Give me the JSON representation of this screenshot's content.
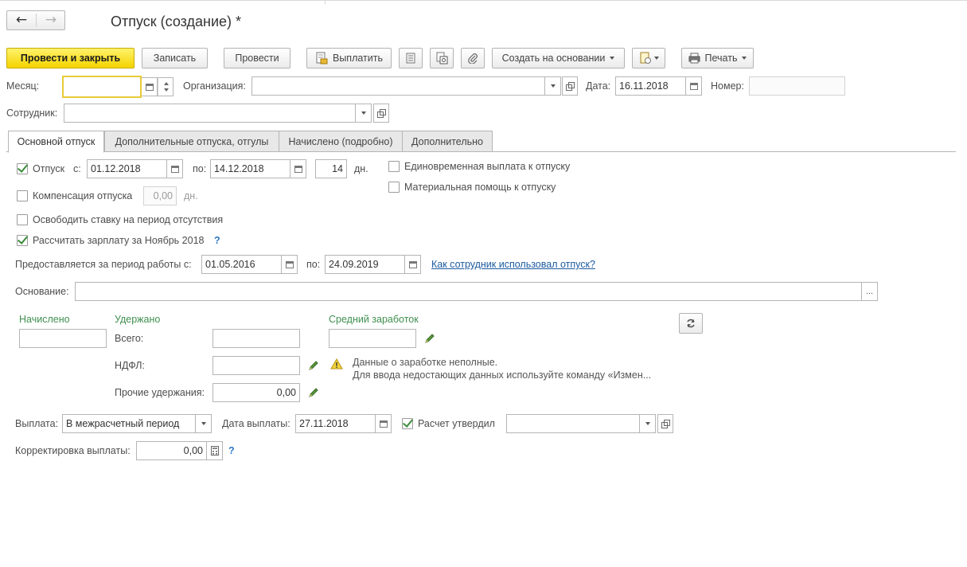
{
  "window": {
    "title": "Отпуск (создание) *"
  },
  "toolbar": {
    "post_close": "Провести и закрыть",
    "save": "Записать",
    "post": "Провести",
    "pay": "Выплатить",
    "create_based": "Создать на основании",
    "print": "Печать"
  },
  "header": {
    "month_label": "Месяц:",
    "month_value": "",
    "org_label": "Организация:",
    "org_value": "",
    "date_label": "Дата:",
    "date_value": "16.11.2018",
    "number_label": "Номер:",
    "number_value": "",
    "employee_label": "Сотрудник:",
    "employee_value": ""
  },
  "tabs": [
    {
      "label": "Основной отпуск",
      "active": true
    },
    {
      "label": "Дополнительные отпуска, отгулы",
      "active": false
    },
    {
      "label": "Начислено (подробно)",
      "active": false
    },
    {
      "label": "Дополнительно",
      "active": false
    }
  ],
  "vacation": {
    "checked": true,
    "label": "Отпуск",
    "from_label": "с:",
    "from_value": "01.12.2018",
    "to_label": "по:",
    "to_value": "14.12.2018",
    "days_value": "14",
    "days_unit": "дн."
  },
  "compensation": {
    "checked": false,
    "label": "Компенсация отпуска",
    "value": "0,00",
    "unit": "дн."
  },
  "free_rate": {
    "checked": false,
    "label": "Освободить ставку на период отсутствия"
  },
  "calc_salary": {
    "checked": true,
    "label": "Рассчитать зарплату за Ноябрь 2018",
    "help": "?"
  },
  "lump_sum": {
    "checked": false,
    "label": "Единовременная выплата к отпуску"
  },
  "material_aid": {
    "checked": false,
    "label": "Материальная помощь к отпуску"
  },
  "work_period": {
    "label": "Предоставляется за период работы с:",
    "from_value": "01.05.2016",
    "to_label": "по:",
    "to_value": "24.09.2019",
    "link": "Как сотрудник использовал отпуск?"
  },
  "basis": {
    "label": "Основание:",
    "value": "",
    "more": "..."
  },
  "totals": {
    "accrued_label": "Начислено",
    "accrued_value": "",
    "withheld_label": "Удержано",
    "total_label": "Всего:",
    "total_value": "",
    "ndfl_label": "НДФЛ:",
    "ndfl_value": "",
    "other_label": "Прочие удержания:",
    "other_value": "0,00",
    "avg_label": "Средний заработок",
    "avg_value": ""
  },
  "warning": {
    "line1": "Данные о заработке неполные.",
    "line2": "Для ввода недостающих данных используйте команду «Измен..."
  },
  "payment": {
    "label": "Выплата:",
    "value": "В межрасчетный период",
    "date_label": "Дата выплаты:",
    "date_value": "27.11.2018",
    "approved_checked": true,
    "approved_label": "Расчет утвердил",
    "approved_value": ""
  },
  "correction": {
    "label": "Корректировка выплаты:",
    "value": "0,00",
    "help": "?"
  },
  "colors": {
    "primary_button": "#f4d400",
    "focus_border": "#e8cb39",
    "section_label": "#3f8f4f",
    "link": "#1d5ba0",
    "check": "#3c8c3c"
  }
}
